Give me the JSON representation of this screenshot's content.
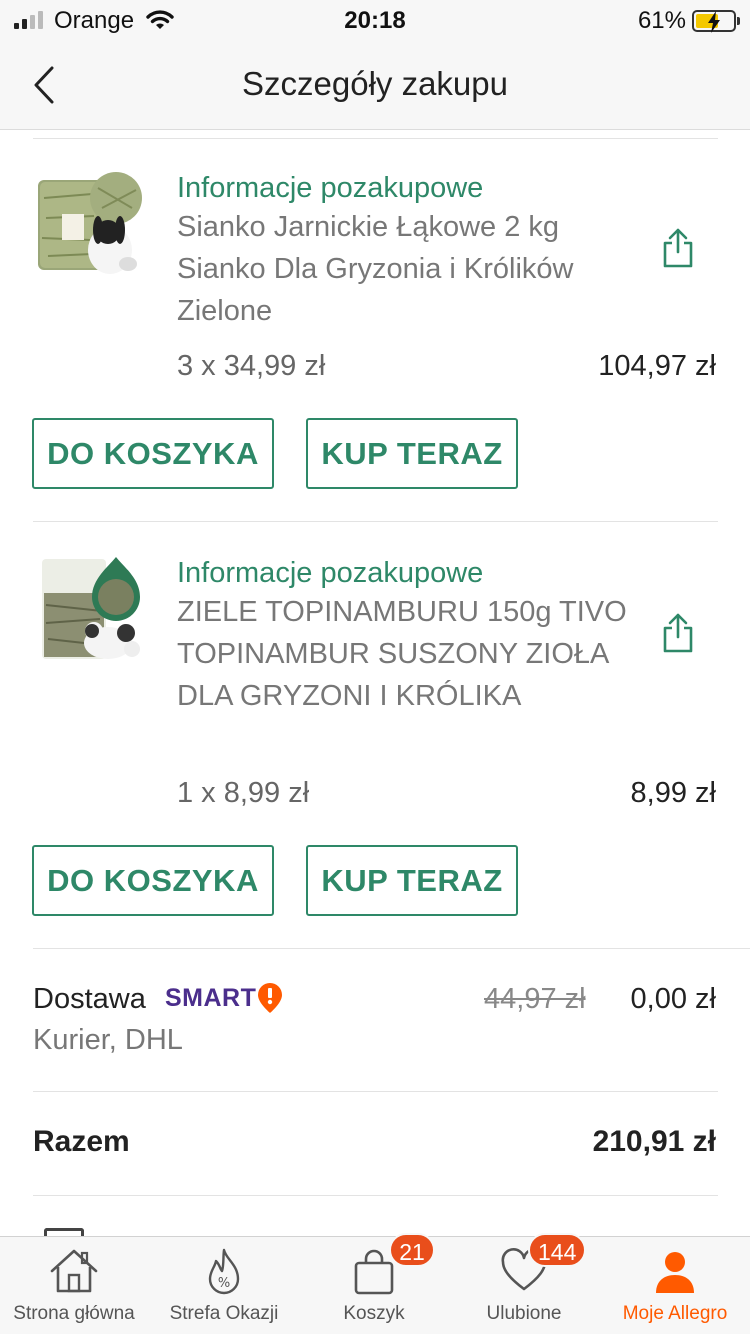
{
  "status_bar": {
    "carrier": "Orange",
    "time": "20:18",
    "battery_percent": "61%",
    "battery_level": 0.61,
    "battery_color": "#f4c800"
  },
  "header": {
    "back_icon": "chevron-left-icon",
    "title": "Szczegóły zakupu"
  },
  "items": [
    {
      "info_label": "Informacje pozakupowe",
      "name": "Sianko Jarnickie Łąkowe 2 kg Sianko Dla Gryzonia i Królików Zielone",
      "quantity_price": "3 x 34,99 zł",
      "total": "104,97 zł",
      "share_icon": "share-icon",
      "thumbnail_icon": "hay-rabbit-product-image",
      "add_to_cart_label": "DO KOSZYKA",
      "buy_now_label": "KUP TERAZ"
    },
    {
      "info_label": "Informacje pozakupowe",
      "name": "ZIELE TOPINAMBURU 150g TIVO TOPINAMBUR SUSZONY ZIOŁA DLA GRYZONI I KRÓLIKA",
      "quantity_price": "1 x 8,99 zł",
      "total": "8,99 zł",
      "share_icon": "share-icon",
      "thumbnail_icon": "herbs-rabbit-product-image",
      "add_to_cart_label": "DO KOSZYKA",
      "buy_now_label": "KUP TERAZ"
    }
  ],
  "delivery": {
    "label": "Dostawa",
    "badge": "SMART",
    "badge_icon": "smart-exclamation-icon",
    "method": "Kurier, DHL",
    "old_price": "44,97 zł",
    "price": "0,00 zł"
  },
  "total": {
    "label": "Razem",
    "value": "210,91 zł"
  },
  "tabbar": {
    "tabs": [
      {
        "label": "Strona główna",
        "icon": "home-icon",
        "active": false
      },
      {
        "label": "Strefa Okazji",
        "icon": "flame-percent-icon",
        "active": false
      },
      {
        "label": "Koszyk",
        "icon": "shopping-bag-icon",
        "badge": "21",
        "active": false
      },
      {
        "label": "Ulubione",
        "icon": "heart-icon",
        "badge": "144",
        "active": false
      },
      {
        "label": "Moje Allegro",
        "icon": "user-icon",
        "active": true
      }
    ]
  },
  "colors": {
    "accent_green": "#2e8868",
    "brand_orange": "#ff5a00",
    "badge_red": "#e94e1b",
    "smart_purple": "#4b2e8c"
  }
}
